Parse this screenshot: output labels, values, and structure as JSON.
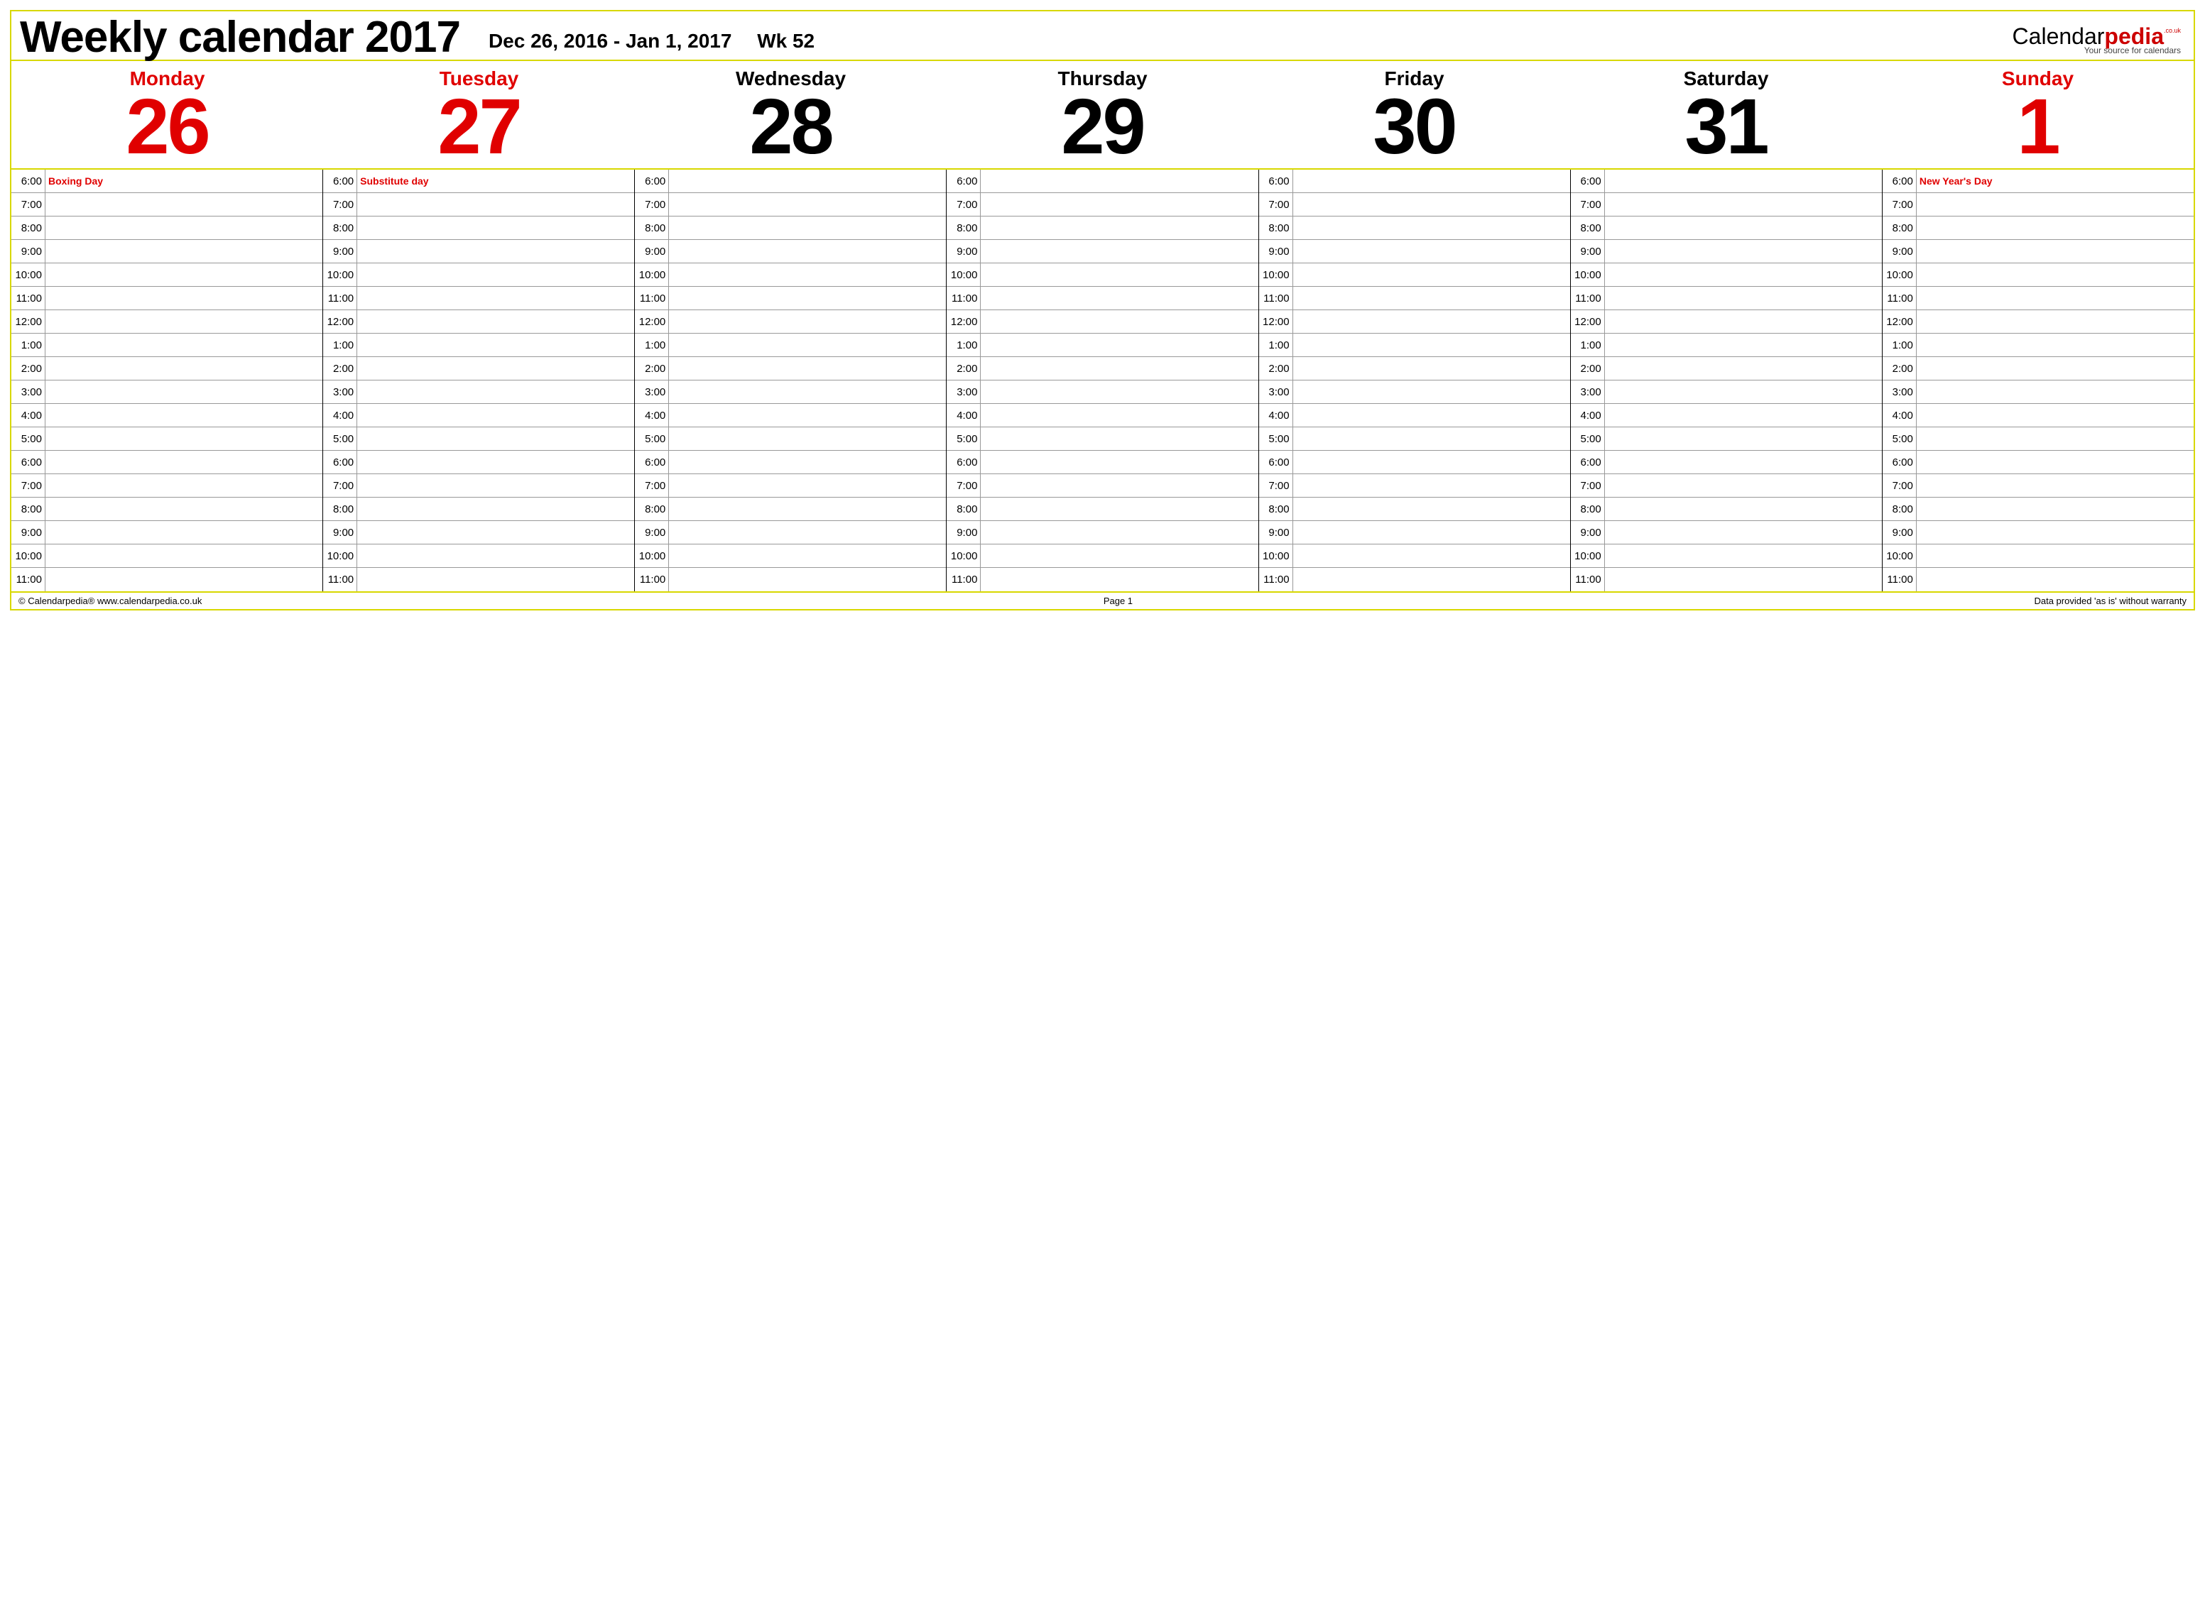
{
  "header": {
    "title": "Weekly calendar 2017",
    "date_range": "Dec 26, 2016 - Jan 1, 2017",
    "week_label": "Wk 52",
    "brand_black": "Calendar",
    "brand_red": "pedia",
    "brand_couk": ".co.uk",
    "brand_sub": "Your source for calendars"
  },
  "days": [
    {
      "dow": "Monday",
      "num": "26",
      "holiday": true,
      "event": "Boxing Day"
    },
    {
      "dow": "Tuesday",
      "num": "27",
      "holiday": true,
      "event": "Substitute day"
    },
    {
      "dow": "Wednesday",
      "num": "28",
      "holiday": false,
      "event": ""
    },
    {
      "dow": "Thursday",
      "num": "29",
      "holiday": false,
      "event": ""
    },
    {
      "dow": "Friday",
      "num": "30",
      "holiday": false,
      "event": ""
    },
    {
      "dow": "Saturday",
      "num": "31",
      "holiday": false,
      "event": ""
    },
    {
      "dow": "Sunday",
      "num": "1",
      "holiday": true,
      "event": "New Year's Day"
    }
  ],
  "hours": [
    "6:00",
    "7:00",
    "8:00",
    "9:00",
    "10:00",
    "11:00",
    "12:00",
    "1:00",
    "2:00",
    "3:00",
    "4:00",
    "5:00",
    "6:00",
    "7:00",
    "8:00",
    "9:00",
    "10:00",
    "11:00"
  ],
  "footer": {
    "left": "© Calendarpedia®   www.calendarpedia.co.uk",
    "mid": "Page 1",
    "right": "Data provided 'as is' without warranty"
  }
}
